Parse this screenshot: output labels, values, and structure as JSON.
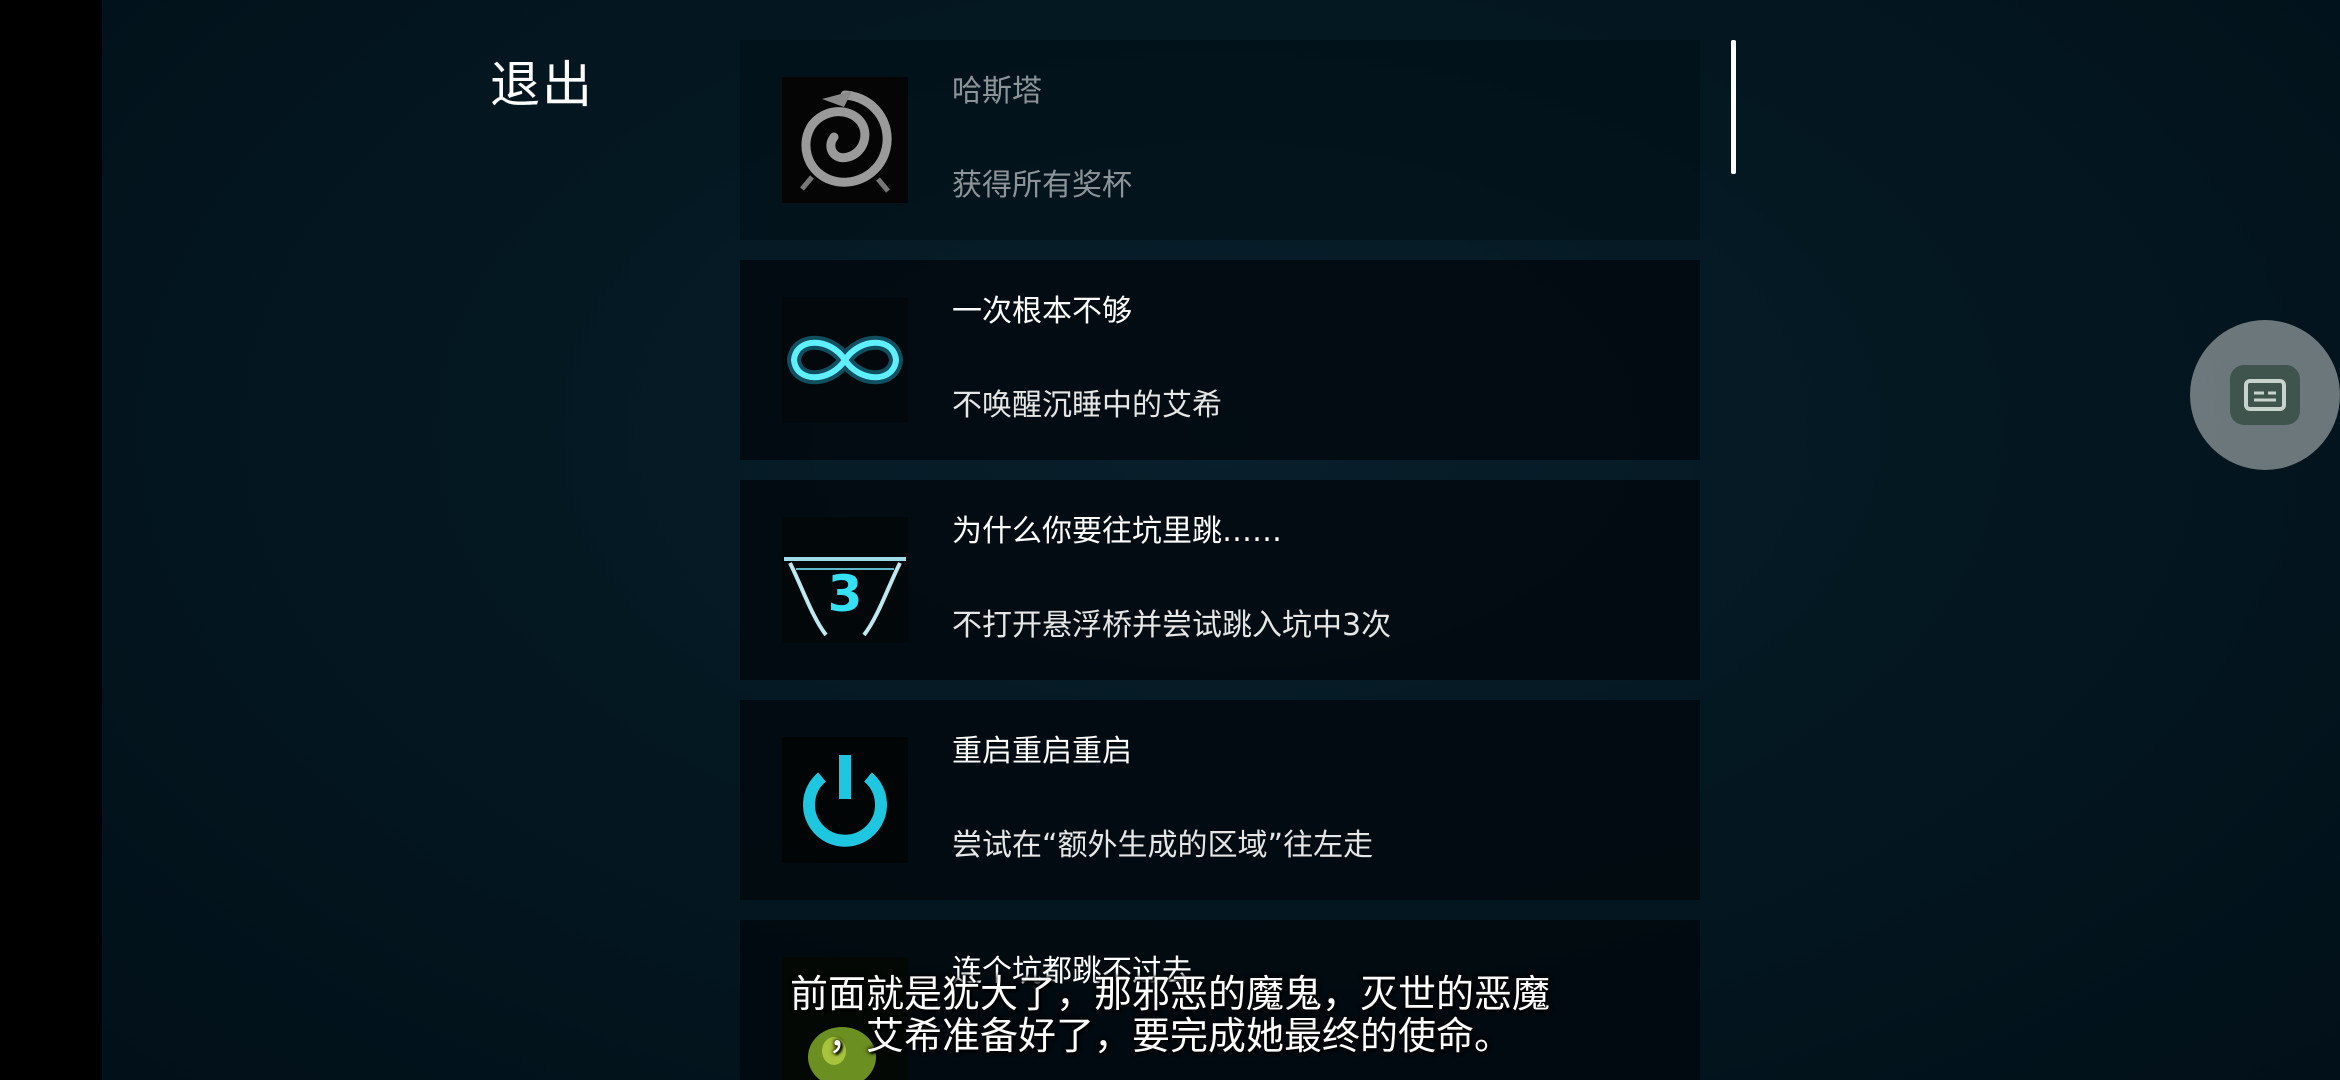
{
  "menu": {
    "exit_label": "退出"
  },
  "achievements": [
    {
      "title": "哈斯塔",
      "desc": "获得所有奖杯",
      "icon": "swirl-emblem-icon",
      "locked": true
    },
    {
      "title": "一次根本不够",
      "desc": "不唤醒沉睡中的艾希",
      "icon": "infinity-icon",
      "locked": false
    },
    {
      "title": "为什么你要往坑里跳……",
      "desc": "不打开悬浮桥并尝试跳入坑中3次",
      "icon": "pit-jump-3-icon",
      "icon_text": "3",
      "locked": false
    },
    {
      "title": "重启重启重启",
      "desc": "尝试在“额外生成的区域”往左走",
      "icon": "power-icon",
      "locked": false
    },
    {
      "title": "连个坑都跳不过去",
      "desc": "",
      "icon": "green-character-icon",
      "locked": false
    }
  ],
  "subtitle": {
    "line1": "前面就是犹大了，那邪恶的魔鬼，灭世的恶魔",
    "line2": "，艾希准备好了，要完成她最终的使命。"
  },
  "colors": {
    "accent_cyan": "#22d8f0",
    "background": "#031722"
  }
}
